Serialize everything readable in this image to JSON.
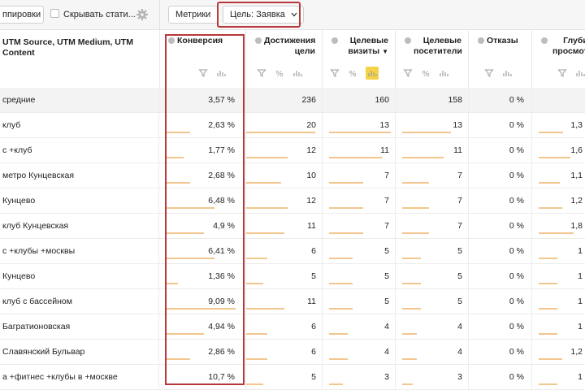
{
  "toolbar": {
    "group_button_label": "ппировки",
    "hide_stats_label": "Скрывать стати...",
    "metrics_button_label": "Метрики",
    "goal_button_label": "Цель: Заявка"
  },
  "dimension_header": "UTM Source, UTM Medium, UTM Content",
  "columns": [
    {
      "label": "Конверсия",
      "sort": ""
    },
    {
      "label": "Достижения цели",
      "sort": ""
    },
    {
      "label": "Целевые визиты",
      "sort": "▼"
    },
    {
      "label": "Целевые посетители",
      "sort": ""
    },
    {
      "label": "Отказы",
      "sort": ""
    },
    {
      "label": "Глубина просмотра",
      "sort": ""
    }
  ],
  "rows": [
    {
      "dim": "средние",
      "conv": "3,57 %",
      "goals": "236",
      "visits": "160",
      "visitors": "158",
      "bounce": "0 %",
      "depth": "",
      "is_avg": true,
      "conv_bar": 0,
      "goals_bar": 0,
      "visits_bar": 0,
      "visitors_bar": 0,
      "depth_bar": 0
    },
    {
      "dim": "клуб",
      "conv": "2,63 %",
      "goals": "20",
      "visits": "13",
      "visitors": "13",
      "bounce": "0 %",
      "depth": "1,3",
      "conv_bar": 0.35,
      "goals_bar": 1.0,
      "visits_bar": 1.0,
      "visitors_bar": 1.0,
      "depth_bar": 0.55
    },
    {
      "dim": "с +клуб",
      "conv": "1,77 %",
      "goals": "12",
      "visits": "11",
      "visitors": "11",
      "bounce": "0 %",
      "depth": "1,6",
      "conv_bar": 0.25,
      "goals_bar": 0.6,
      "visits_bar": 0.85,
      "visitors_bar": 0.85,
      "depth_bar": 0.7
    },
    {
      "dim": "метро Кунцевская",
      "conv": "2,68 %",
      "goals": "10",
      "visits": "7",
      "visitors": "7",
      "bounce": "0 %",
      "depth": "1,1",
      "conv_bar": 0.35,
      "goals_bar": 0.5,
      "visits_bar": 0.55,
      "visitors_bar": 0.55,
      "depth_bar": 0.48
    },
    {
      "dim": "Кунцево",
      "conv": "6,48 %",
      "goals": "12",
      "visits": "7",
      "visitors": "7",
      "bounce": "0 %",
      "depth": "1,2",
      "conv_bar": 0.7,
      "goals_bar": 0.6,
      "visits_bar": 0.55,
      "visitors_bar": 0.55,
      "depth_bar": 0.52
    },
    {
      "dim": "клуб Кунцевская",
      "conv": "4,9 %",
      "goals": "11",
      "visits": "7",
      "visitors": "7",
      "bounce": "0 %",
      "depth": "1,8",
      "conv_bar": 0.55,
      "goals_bar": 0.55,
      "visits_bar": 0.55,
      "visitors_bar": 0.55,
      "depth_bar": 0.78
    },
    {
      "dim": "с +клубы +москвы",
      "conv": "6,41 %",
      "goals": "6",
      "visits": "5",
      "visitors": "5",
      "bounce": "0 %",
      "depth": "1",
      "conv_bar": 0.7,
      "goals_bar": 0.3,
      "visits_bar": 0.38,
      "visitors_bar": 0.38,
      "depth_bar": 0.42
    },
    {
      "dim": "Кунцево",
      "conv": "1,36 %",
      "goals": "5",
      "visits": "5",
      "visitors": "5",
      "bounce": "0 %",
      "depth": "1",
      "conv_bar": 0.18,
      "goals_bar": 0.25,
      "visits_bar": 0.38,
      "visitors_bar": 0.38,
      "depth_bar": 0.42
    },
    {
      "dim": "клуб с бассейном",
      "conv": "9,09 %",
      "goals": "11",
      "visits": "5",
      "visitors": "5",
      "bounce": "0 %",
      "depth": "1",
      "conv_bar": 1.0,
      "goals_bar": 0.55,
      "visits_bar": 0.38,
      "visitors_bar": 0.38,
      "depth_bar": 0.42
    },
    {
      "dim": "Багратионовская",
      "conv": "4,94 %",
      "goals": "6",
      "visits": "4",
      "visitors": "4",
      "bounce": "0 %",
      "depth": "1",
      "conv_bar": 0.55,
      "goals_bar": 0.3,
      "visits_bar": 0.3,
      "visitors_bar": 0.3,
      "depth_bar": 0.42
    },
    {
      "dim": "Славянский Бульвар",
      "conv": "2,86 %",
      "goals": "6",
      "visits": "4",
      "visitors": "4",
      "bounce": "0 %",
      "depth": "1,2",
      "conv_bar": 0.35,
      "goals_bar": 0.3,
      "visits_bar": 0.3,
      "visitors_bar": 0.3,
      "depth_bar": 0.52
    },
    {
      "dim": "а +фитнес +клубы в +москве",
      "conv": "10,7 %",
      "goals": "5",
      "visits": "3",
      "visitors": "3",
      "bounce": "0 %",
      "depth": "1",
      "conv_bar": 1.0,
      "goals_bar": 0.25,
      "visits_bar": 0.22,
      "visitors_bar": 0.22,
      "depth_bar": 0.42
    }
  ],
  "colors": {
    "highlight": "#b8373b",
    "bar": "#f2c68e",
    "active_icon": "#f5d347"
  }
}
